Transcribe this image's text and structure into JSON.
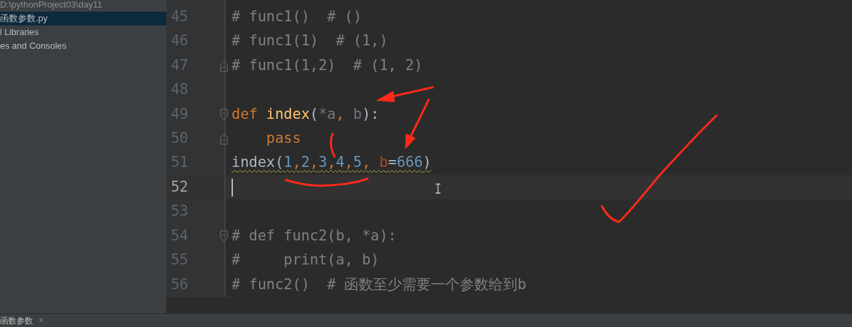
{
  "sidebar": {
    "items": [
      {
        "label": "D:\\pythonProject03\\day11",
        "kind": "path",
        "selected": false
      },
      {
        "label": "函数参数.py",
        "kind": "file",
        "selected": true
      },
      {
        "label": "l Libraries",
        "kind": "node",
        "selected": false
      },
      {
        "label": "es and Consoles",
        "kind": "node",
        "selected": false
      }
    ]
  },
  "editor": {
    "lines": [
      {
        "number": "45",
        "current": false,
        "tokens": [
          {
            "text": "# func1()  # ()",
            "kind": "comment"
          }
        ]
      },
      {
        "number": "46",
        "current": false,
        "tokens": [
          {
            "text": "# func1(1)  # (1,)",
            "kind": "comment"
          }
        ]
      },
      {
        "number": "47",
        "current": false,
        "fold_end": true,
        "tokens": [
          {
            "text": "# func1(1,2)  # (1, 2)",
            "kind": "comment"
          }
        ]
      },
      {
        "number": "48",
        "current": false
      },
      {
        "number": "49",
        "current": false,
        "fold_start": true,
        "tokens": [
          {
            "text": "def",
            "kind": "keyword"
          },
          {
            "text": " index",
            "kind": "function"
          },
          {
            "text": "(",
            "kind": "plain"
          },
          {
            "text": "*a",
            "kind": "unused"
          },
          {
            "text": ",",
            "kind": "keyword"
          },
          {
            "text": " b",
            "kind": "unused"
          },
          {
            "text": "):",
            "kind": "plain"
          }
        ]
      },
      {
        "number": "50",
        "current": false,
        "fold_end": true,
        "tokens": [
          {
            "text": "    pass",
            "kind": "keyword"
          }
        ]
      },
      {
        "number": "51",
        "current": false,
        "warning": true,
        "tokens": [
          {
            "text": "index(",
            "kind": "plain"
          },
          {
            "text": "1",
            "kind": "number"
          },
          {
            "text": ",",
            "kind": "keyword"
          },
          {
            "text": "2",
            "kind": "number"
          },
          {
            "text": ",",
            "kind": "keyword"
          },
          {
            "text": "3",
            "kind": "number"
          },
          {
            "text": ",",
            "kind": "keyword"
          },
          {
            "text": "4",
            "kind": "number"
          },
          {
            "text": ",",
            "kind": "keyword"
          },
          {
            "text": "5",
            "kind": "number"
          },
          {
            "text": ",",
            "kind": "keyword"
          },
          {
            "text": " b",
            "kind": "named"
          },
          {
            "text": "=",
            "kind": "plain"
          },
          {
            "text": "666",
            "kind": "number"
          },
          {
            "text": ")",
            "kind": "plain"
          }
        ]
      },
      {
        "number": "52",
        "current": true
      },
      {
        "number": "53",
        "current": false
      },
      {
        "number": "54",
        "current": false,
        "fold_start": true,
        "tokens": [
          {
            "text": "# def func2(b, *a):",
            "kind": "comment"
          }
        ]
      },
      {
        "number": "55",
        "current": false,
        "tokens": [
          {
            "text": "#     print(a, b)",
            "kind": "comment"
          }
        ]
      },
      {
        "number": "56",
        "current": false,
        "tokens": [
          {
            "text": "# func2()  # 函数至少需要一个参数给到b",
            "kind": "comment"
          }
        ]
      }
    ]
  },
  "bottom_tabs": [
    {
      "label": "函数参数",
      "close": "×",
      "selected": true
    }
  ]
}
